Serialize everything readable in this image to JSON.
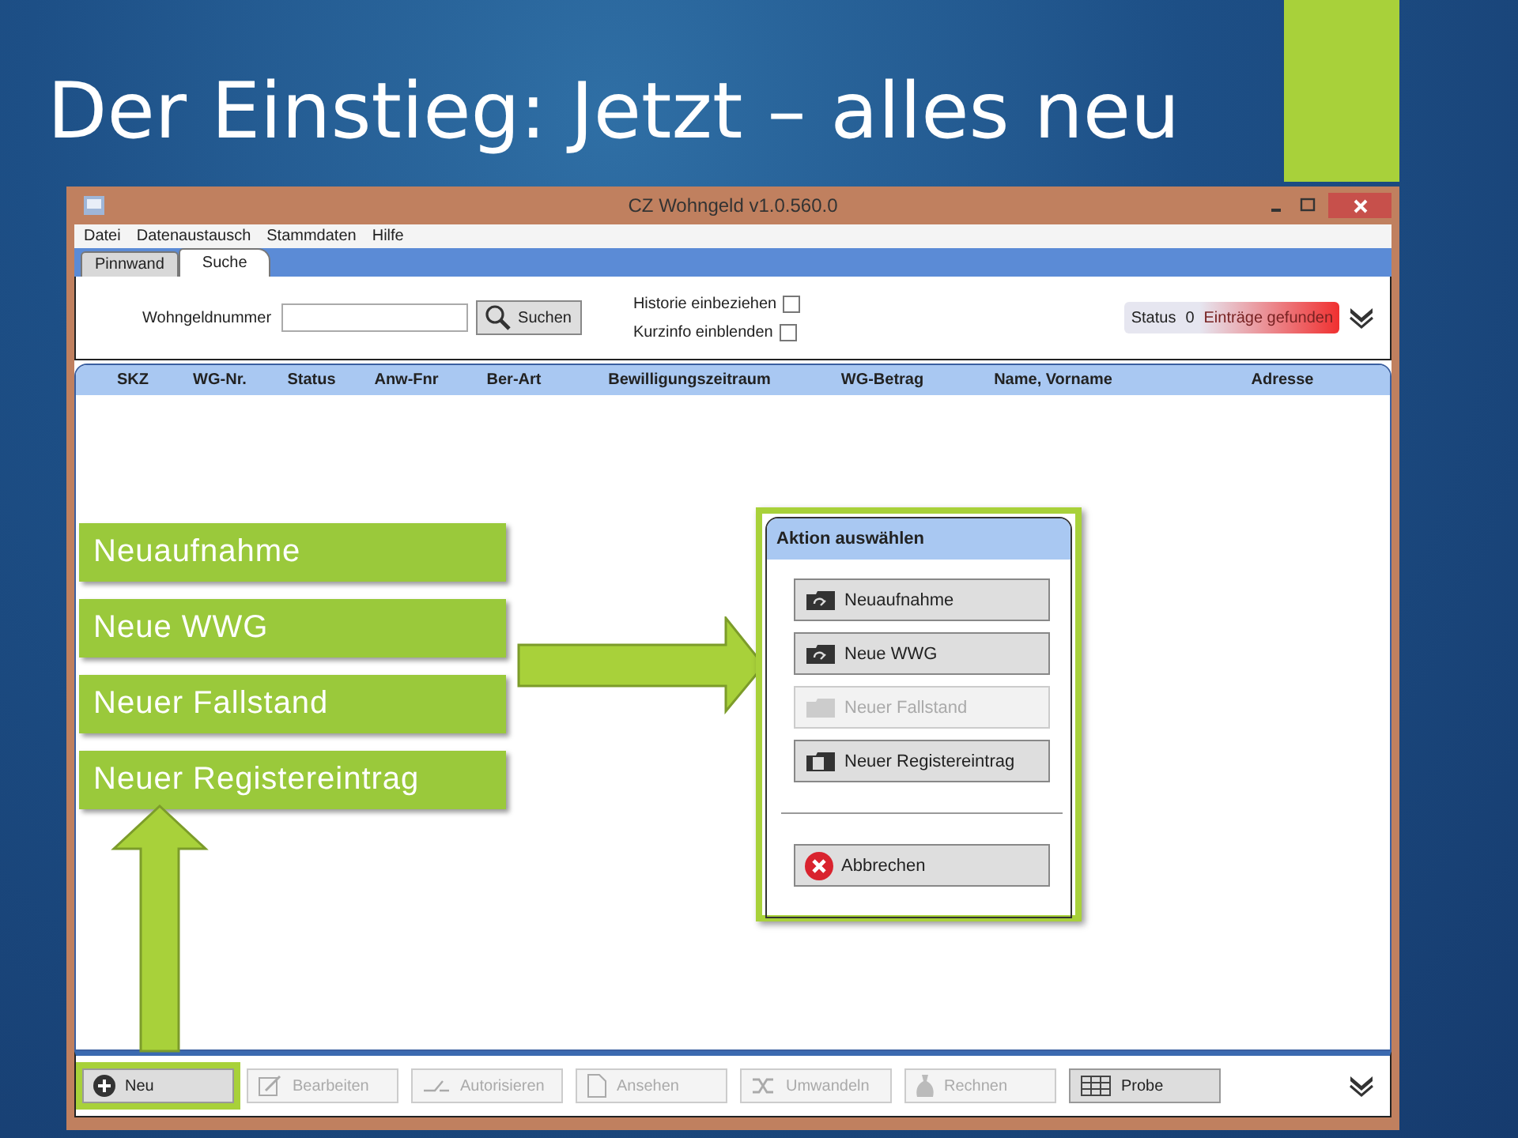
{
  "slide": {
    "title": "Der Einstieg: Jetzt – alles neu"
  },
  "window": {
    "title": "CZ Wohngeld v1.0.560.0"
  },
  "menu": [
    "Datei",
    "Datenaustausch",
    "Stammdaten",
    "Hilfe"
  ],
  "tabs": [
    {
      "label": "Pinnwand",
      "selected": false
    },
    {
      "label": "Suche",
      "selected": true
    }
  ],
  "search": {
    "label": "Wohngeldnummer",
    "button": "Suchen"
  },
  "options": [
    {
      "label": "Historie einbeziehen",
      "checked": false
    },
    {
      "label": "Kurzinfo einblenden",
      "checked": false
    }
  ],
  "status": {
    "label": "Status",
    "count": "0",
    "message": "Einträge gefunden"
  },
  "table": {
    "columns": [
      "SKZ",
      "WG-Nr.",
      "Status",
      "Anw-Fnr",
      "Ber-Art",
      "Bewilligungszeitraum",
      "WG-Betrag",
      "Name, Vorname",
      "Adresse"
    ]
  },
  "toolbar": [
    {
      "label": "Neu",
      "kind": "plus",
      "disabled": false,
      "highlighted": true
    },
    {
      "label": "Bearbeiten",
      "kind": "edit",
      "disabled": true,
      "highlighted": false
    },
    {
      "label": "Autorisieren",
      "kind": "sign",
      "disabled": true,
      "highlighted": false
    },
    {
      "label": "Ansehen",
      "kind": "page",
      "disabled": true,
      "highlighted": false
    },
    {
      "label": "Umwandeln",
      "kind": "shuffle",
      "disabled": true,
      "highlighted": false
    },
    {
      "label": "Rechnen",
      "kind": "bag",
      "disabled": true,
      "highlighted": false
    },
    {
      "label": "Probe",
      "kind": "grid",
      "disabled": false,
      "highlighted": false
    }
  ],
  "callouts": [
    "Neuaufnahme",
    "Neue WWG",
    "Neuer Fallstand",
    "Neuer Registereintrag"
  ],
  "dialog": {
    "title": "Aktion auswählen",
    "buttons": [
      {
        "label": "Neuaufnahme",
        "kind": "folder",
        "disabled": false
      },
      {
        "label": "Neue WWG",
        "kind": "folder",
        "disabled": false
      },
      {
        "label": "Neuer Fallstand",
        "kind": "folder",
        "disabled": true
      },
      {
        "label": "Neuer Registereintrag",
        "kind": "register",
        "disabled": false
      }
    ],
    "cancel": "Abbrechen"
  }
}
